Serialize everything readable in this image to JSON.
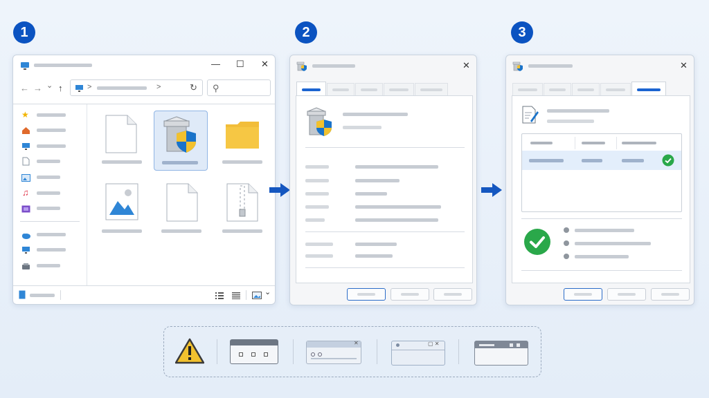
{
  "steps": [
    {
      "number": "1"
    },
    {
      "number": "2"
    },
    {
      "number": "3"
    }
  ],
  "colors": {
    "accent": "#0b53c1",
    "success": "#2aa84a",
    "warning": "#f2c12e",
    "shield_blue": "#1a73c9",
    "folder": "#f6c744"
  },
  "explorer": {
    "icons": {
      "window": "computer-icon",
      "sidebar": [
        "star-icon",
        "home-icon",
        "desktop-icon",
        "document-icon",
        "pictures-icon",
        "music-icon",
        "video-icon",
        "cloud-icon",
        "this-pc-icon",
        "drive-icon"
      ],
      "files": [
        "blank-file-icon",
        "installer-shield-icon",
        "folder-icon",
        "image-file-icon",
        "blank-file-icon",
        "zip-file-icon"
      ]
    },
    "selected_file_index": 1,
    "window_controls": [
      "—",
      "☐",
      "✕"
    ],
    "nav_glyphs": [
      "←",
      "→",
      "⌄",
      "↑"
    ],
    "breadcrumb_separators": [
      ">",
      ">"
    ],
    "refresh_glyph": "↻",
    "search_glyph": "⚲",
    "view_dropdown_glyph": "⌄"
  },
  "properties_dialog": {
    "close_glyph": "✕",
    "tab_count": 5,
    "active_tab_index": 0,
    "icon": "installer-shield-icon"
  },
  "security_dialog": {
    "close_glyph": "✕",
    "tab_count": 5,
    "active_tab_index": 4,
    "table_row_status": "check-icon",
    "summary_icon": "success-check-icon"
  },
  "bottom_strip": {
    "icons": [
      "warning-icon",
      "window-variant-dark-titlebar",
      "window-variant-light-titlebar",
      "window-variant-outline",
      "window-variant-gray-titlebar"
    ]
  }
}
